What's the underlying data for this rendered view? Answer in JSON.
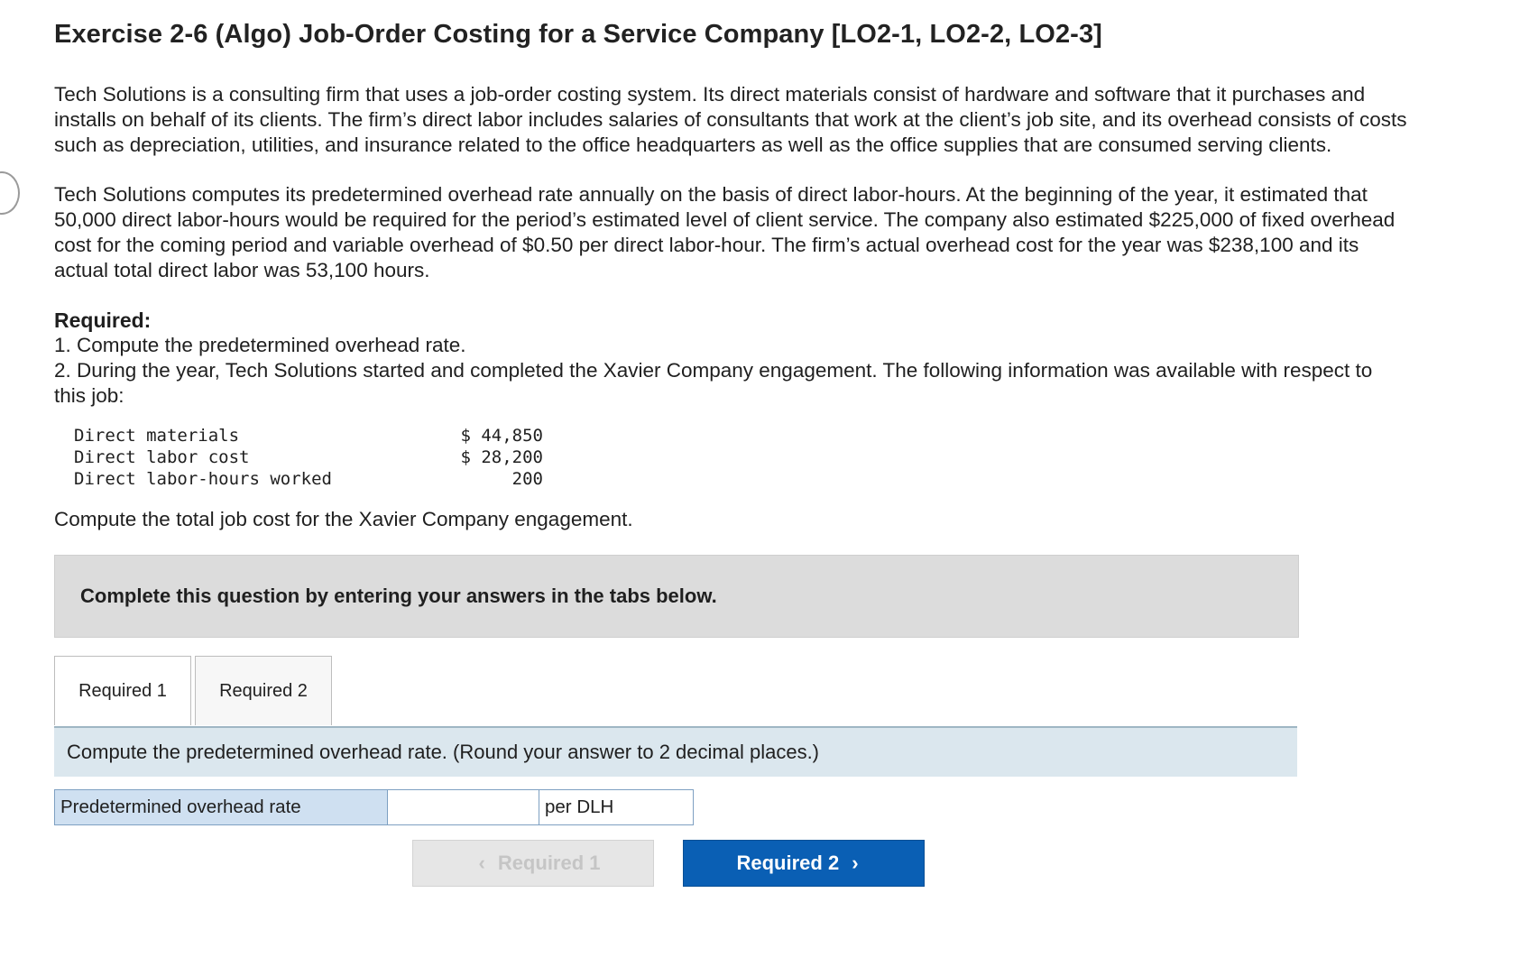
{
  "title": "Exercise 2-6 (Algo) Job-Order Costing for a Service Company [LO2-1, LO2-2, LO2-3]",
  "paragraphs": {
    "p1": "Tech Solutions is a consulting firm that uses a job-order costing system. Its direct materials consist of hardware and software that it purchases and installs on behalf of its clients. The firm’s direct labor includes salaries of consultants that work at the client’s job site, and its overhead consists of costs such as depreciation, utilities, and insurance related to the office headquarters as well as the office supplies that are consumed serving clients.",
    "p2": "Tech Solutions computes its predetermined overhead rate annually on the basis of direct labor-hours. At the beginning of the year, it estimated that 50,000 direct labor-hours would be required for the period’s estimated level of client service. The company also estimated $225,000 of fixed overhead cost for the coming period and variable overhead of $0.50 per direct labor-hour. The firm’s actual overhead cost for the year was $238,100 and its actual total direct labor was 53,100 hours."
  },
  "required": {
    "heading": "Required:",
    "item1": "1. Compute the predetermined overhead rate.",
    "item2": "2. During the year, Tech Solutions started and completed the Xavier Company engagement. The following information was available with respect to this job:"
  },
  "job_table": [
    {
      "label": "Direct materials",
      "value": "$ 44,850"
    },
    {
      "label": "Direct labor cost",
      "value": "$ 28,200"
    },
    {
      "label": "Direct labor-hours worked",
      "value": "200"
    }
  ],
  "compute_total": "Compute the total job cost for the Xavier Company engagement.",
  "panel": {
    "text": "Complete this question by entering your answers in the tabs below."
  },
  "tabs": [
    {
      "label": "Required 1"
    },
    {
      "label": "Required 2"
    }
  ],
  "instruction": "Compute the predetermined overhead rate. (Round your answer to 2 decimal places.)",
  "answer": {
    "label": "Predetermined overhead rate",
    "value": "",
    "unit": "per DLH"
  },
  "nav": {
    "prev_label": "Required 1",
    "next_label": "Required 2"
  },
  "colors": {
    "next_button": "#0a5fb4",
    "answer_label_bg": "#cfe0f1",
    "instruction_bg": "#dbe7ee",
    "panel_bg": "#dcdcdc"
  }
}
